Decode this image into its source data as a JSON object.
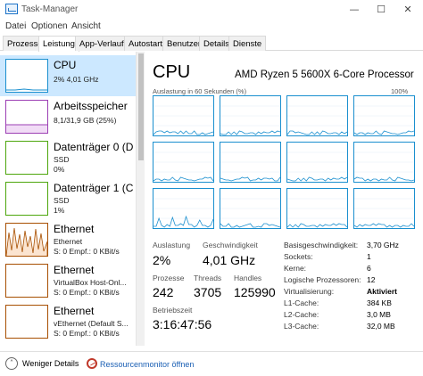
{
  "window": {
    "title": "Task-Manager"
  },
  "menu": [
    "Datei",
    "Optionen",
    "Ansicht"
  ],
  "tabs": [
    "Prozesse",
    "Leistung",
    "App-Verlauf",
    "Autostart",
    "Benutzer",
    "Details",
    "Dienste"
  ],
  "active_tab": "Leistung",
  "sidebar": [
    {
      "name": "CPU",
      "line1": "2% 4,01 GHz",
      "line2": "",
      "color": "#1a8fcf"
    },
    {
      "name": "Arbeitsspeicher",
      "line1": "8,1/31,9 GB (25%)",
      "line2": "",
      "color": "#9c3fb4"
    },
    {
      "name": "Datenträger 0 (D:)",
      "line1": "SSD",
      "line2": "0%",
      "color": "#4da60c"
    },
    {
      "name": "Datenträger 1 (C:)",
      "line1": "SSD",
      "line2": "1%",
      "color": "#4da60c"
    },
    {
      "name": "Ethernet",
      "line1": "Ethernet",
      "line2": "S: 0 Empf.: 0 KBit/s",
      "color": "#a74f01"
    },
    {
      "name": "Ethernet",
      "line1": "VirtualBox Host-Onl...",
      "line2": "S: 0 Empf.: 0 KBit/s",
      "color": "#a74f01"
    },
    {
      "name": "Ethernet",
      "line1": "vEthernet (Default S...",
      "line2": "S: 0 Empf.: 0 KBit/s",
      "color": "#a74f01"
    }
  ],
  "main": {
    "title": "CPU",
    "model": "AMD Ryzen 5 5600X 6-Core Processor",
    "graph_label": "Auslastung in 60 Sekunden (%)",
    "graph_max": "100%",
    "graph_color": "#1a8fcf",
    "stats": {
      "auslastung_label": "Auslastung",
      "auslastung": "2%",
      "geschwindigkeit_label": "Geschwindigkeit",
      "geschwindigkeit": "4,01 GHz",
      "prozesse_label": "Prozesse",
      "prozesse": "242",
      "threads_label": "Threads",
      "threads": "3705",
      "handles_label": "Handles",
      "handles": "125990",
      "betriebszeit_label": "Betriebszeit",
      "betriebszeit": "3:16:47:56"
    },
    "details": [
      {
        "key": "Basisgeschwindigkeit:",
        "value": "3,70 GHz"
      },
      {
        "key": "Sockets:",
        "value": "1"
      },
      {
        "key": "Kerne:",
        "value": "6"
      },
      {
        "key": "Logische Prozessoren:",
        "value": "12"
      },
      {
        "key": "Virtualisierung:",
        "value": "Aktiviert"
      },
      {
        "key": "L1-Cache:",
        "value": "384 KB"
      },
      {
        "key": "L2-Cache:",
        "value": "3,0 MB"
      },
      {
        "key": "L3-Cache:",
        "value": "32,0 MB"
      }
    ]
  },
  "footer": {
    "fewer_details": "Weniger Details",
    "resource_monitor": "Ressourcenmonitor öffnen"
  }
}
